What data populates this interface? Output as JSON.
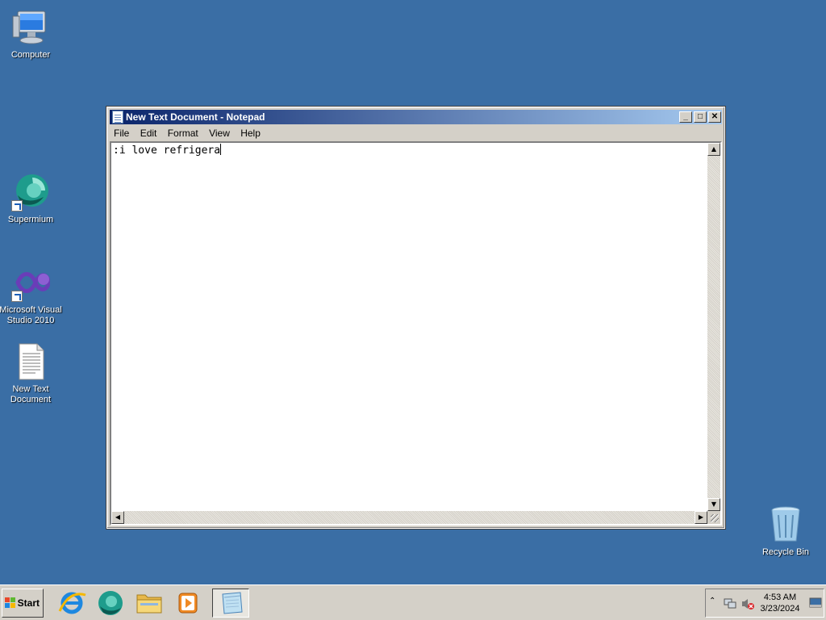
{
  "desktop": {
    "icons": [
      {
        "label": "Computer"
      },
      {
        "label": "Supermium"
      },
      {
        "label": "Microsoft Visual Studio 2010"
      },
      {
        "label": "New Text Document"
      },
      {
        "label": "Recycle Bin"
      }
    ]
  },
  "window": {
    "title": "New Text Document - Notepad",
    "menu": [
      "File",
      "Edit",
      "Format",
      "View",
      "Help"
    ],
    "controls": {
      "minimize": "_",
      "maximize": "□",
      "close": "✕"
    },
    "content": ":i love refrigera"
  },
  "taskbar": {
    "start_label": "Start",
    "apps": [
      "internet-explorer",
      "supermium",
      "file-explorer",
      "media-player",
      "notepad"
    ],
    "clock": {
      "time": "4:53 AM",
      "date": "3/23/2024"
    }
  },
  "colors": {
    "desktop": "#3a6ea5",
    "titlebar_start": "#0a246a",
    "titlebar_end": "#a6caf0",
    "chrome": "#d4d0c8"
  }
}
